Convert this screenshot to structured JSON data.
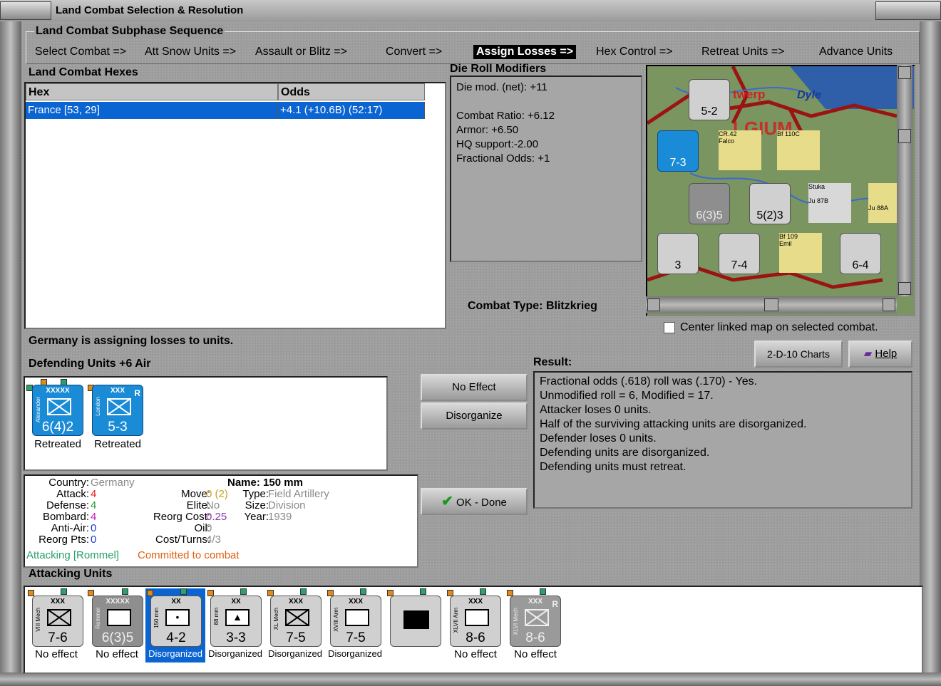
{
  "window": {
    "title": "Land Combat Selection & Resolution"
  },
  "subphase": {
    "title": "Land Combat Subphase Sequence",
    "steps": [
      "Select Combat =>",
      "Att Snow Units =>",
      "Assault or Blitz =>",
      "Convert =>",
      "Assign Losses =>",
      "Hex Control =>",
      "Retreat Units =>",
      "Advance Units"
    ],
    "current": "Assign Losses =>"
  },
  "hexes": {
    "title": "Land Combat Hexes",
    "columns": [
      "Hex",
      "Odds"
    ],
    "rows": [
      {
        "hex": "France [53, 29]",
        "odds": "+4.1 (+10.6B) (52:17)"
      }
    ]
  },
  "drm": {
    "title": "Die Roll Modifiers",
    "lines": [
      "Die mod. (net): +11",
      "",
      "Combat Ratio: +6.12",
      "Armor: +6.50",
      "HQ support:-2.00",
      "Fractional Odds: +1"
    ]
  },
  "combat_type": {
    "label": "Combat Type:",
    "value": "Blitzkrieg"
  },
  "map": {
    "labels": [
      "twerp",
      "Dyle",
      "LGIUM"
    ],
    "counters": [
      {
        "name": "7-3"
      },
      {
        "name": "5-2"
      },
      {
        "name": "6(3)5"
      },
      {
        "name": "5(2)3"
      },
      {
        "name": "7-4"
      },
      {
        "name": "6-4"
      },
      {
        "name": "3"
      }
    ],
    "air": [
      "Bf 110C",
      "CR.42",
      "Falco",
      "Stuka",
      "Ju 87B",
      "Bf 109",
      "Emil",
      "Ju 88A"
    ],
    "center_linked_label": "Center linked map on selected combat."
  },
  "status": "Germany is assigning losses to units.",
  "defending": {
    "title": "Defending Units +6 Air",
    "units": [
      {
        "size": "XXXXX",
        "side": "Alexander",
        "values": "6(4)2",
        "status": "Retreated",
        "reserve": ""
      },
      {
        "size": "XXX",
        "side": "London",
        "values": "5-3",
        "status": "Retreated",
        "reserve": "R",
        "type_letter": "M"
      }
    ]
  },
  "info": {
    "country_label": "Country:",
    "country": "Germany",
    "attack_label": "Attack:",
    "attack": "4",
    "defense_label": "Defense:",
    "defense": "4",
    "bombard_label": "Bombard:",
    "bombard": "4",
    "antiair_label": "Anti-Air:",
    "antiair": "0",
    "reorg_label": "Reorg Pts:",
    "reorg": "0",
    "name_label": "Name:",
    "name": "150 mm",
    "move_label": "Move:",
    "move": "0",
    "move_extra": "(2)",
    "type_label": "Type:",
    "type": "Field Artillery",
    "elite_label": "Elite:",
    "elite": "No",
    "size_label": "Size:",
    "size": "Division",
    "reorg_cost_label": "Reorg Cost:",
    "reorg_cost": "0.25",
    "year_label": "Year:",
    "year": "1939",
    "oil_label": "Oil:",
    "oil": "0",
    "cost_label": "Cost/Turns:",
    "cost": "4/3",
    "attacking": "Attacking [Rommel]",
    "committed": "Committed to combat"
  },
  "buttons": {
    "no_effect": "No Effect",
    "disorganize": "Disorganize",
    "ok": "OK - Done",
    "charts": "2-D-10 Charts",
    "help": "Help"
  },
  "result": {
    "title": "Result:",
    "lines": [
      "Fractional odds (.618) roll was (.170)  - Yes.",
      "Unmodified roll = 6, Modified = 17.",
      "Attacker loses 0 units.",
      "Half of the surviving attacking units are disorganized.",
      "Defender loses 0 units.",
      "Defending units are disorganized.",
      "Defending units must retreat."
    ]
  },
  "attacking": {
    "title": "Attacking Units",
    "units": [
      {
        "size": "XXX",
        "side": "VIII Mech",
        "values": "7-6",
        "status": "No effect"
      },
      {
        "size": "XXXXX",
        "side": "Rommel",
        "values": "6(3)5",
        "status": "No effect"
      },
      {
        "size": "XX",
        "side": "150 mm",
        "values": "4-2",
        "status": "Disorganized"
      },
      {
        "size": "XX",
        "side": "88 mm",
        "values": "3-3",
        "status": "Disorganized"
      },
      {
        "size": "XXX",
        "side": "XL Mech",
        "values": "7-5",
        "status": "Disorganized"
      },
      {
        "size": "XXX",
        "side": "XVIII Arm",
        "values": "7-5",
        "status": "Disorganized"
      },
      {
        "size": "",
        "side": "",
        "values": "",
        "status": ""
      },
      {
        "size": "XXX",
        "side": "XLVII Arm",
        "values": "8-6",
        "status": "No effect"
      },
      {
        "size": "XXX",
        "side": "XLVI Mech",
        "values": "8-6",
        "status": "No effect",
        "reserve": "R"
      }
    ]
  },
  "colors": {
    "selection": "#0a64d2",
    "unit_blue": "#1a8bd6",
    "attack": "#e0201a",
    "defense": "#2a9a2a",
    "bombard": "#c020c0",
    "antiair": "#1a3ad6"
  }
}
